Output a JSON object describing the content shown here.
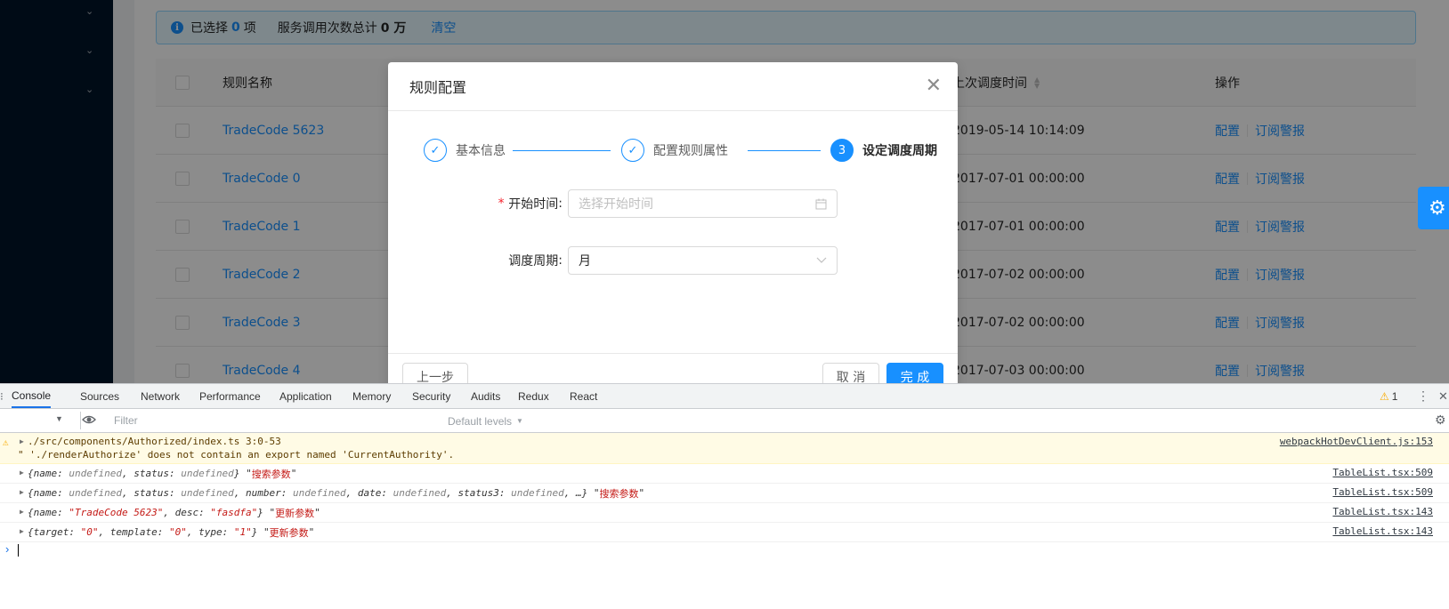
{
  "alert": {
    "selected_prefix": "已选择",
    "selected_count": "0",
    "selected_suffix": "项",
    "total_prefix": "服务调用次数总计",
    "total_value": "0 万",
    "clear_label": "清空"
  },
  "table": {
    "col_name": "规则名称",
    "col_time": "上次调度时间",
    "col_action": "操作",
    "action_config": "配置",
    "action_subscribe": "订阅警报",
    "rows": [
      {
        "name": "TradeCode 5623",
        "time": "2019-05-14 10:14:09"
      },
      {
        "name": "TradeCode 0",
        "time": "2017-07-01 00:00:00"
      },
      {
        "name": "TradeCode 1",
        "time": "2017-07-01 00:00:00"
      },
      {
        "name": "TradeCode 2",
        "time": "2017-07-02 00:00:00"
      },
      {
        "name": "TradeCode 3",
        "time": "2017-07-02 00:00:00"
      },
      {
        "name": "TradeCode 4",
        "time": "2017-07-03 00:00:00"
      }
    ]
  },
  "modal": {
    "title": "规则配置",
    "close_glyph": "✕",
    "steps": [
      {
        "title": "基本信息",
        "status": "finish",
        "icon": "check-icon"
      },
      {
        "title": "配置规则属性",
        "status": "finish",
        "icon": "check-icon"
      },
      {
        "title": "设定调度周期",
        "status": "process",
        "number": "3"
      }
    ],
    "fields": {
      "start_time_label": "开始时间",
      "start_time_placeholder": "选择开始时间",
      "period_label": "调度周期",
      "period_value": "月"
    },
    "footer": {
      "prev_label": "上一步",
      "cancel_label": "取 消",
      "finish_label": "完 成"
    }
  },
  "devtools": {
    "tabs": [
      "Console",
      "Sources",
      "Network",
      "Performance",
      "Application",
      "Memory",
      "Security",
      "Audits",
      "Redux",
      "React"
    ],
    "active_tab": "Console",
    "warning_count": "1",
    "filter_placeholder": "Filter",
    "levels_label": "Default levels",
    "messages": [
      {
        "type": "warning",
        "line1": "./src/components/Authorized/index.ts 3:0-53",
        "line2": "\" './renderAuthorize' does not contain an export named 'CurrentAuthority'.",
        "source": "webpackHotDevClient.js:153"
      },
      {
        "type": "log",
        "source": "TableList.tsx:509",
        "label": "搜索参数"
      },
      {
        "type": "log",
        "source": "TableList.tsx:509",
        "label": "搜索参数"
      },
      {
        "type": "log",
        "source": "TableList.tsx:143",
        "label": "更新参数"
      },
      {
        "type": "log",
        "source": "TableList.tsx:143",
        "label": "更新参数"
      }
    ]
  },
  "colors": {
    "primary": "#1890ff",
    "sider": "#001529",
    "warning_bg": "#fffbe5"
  }
}
